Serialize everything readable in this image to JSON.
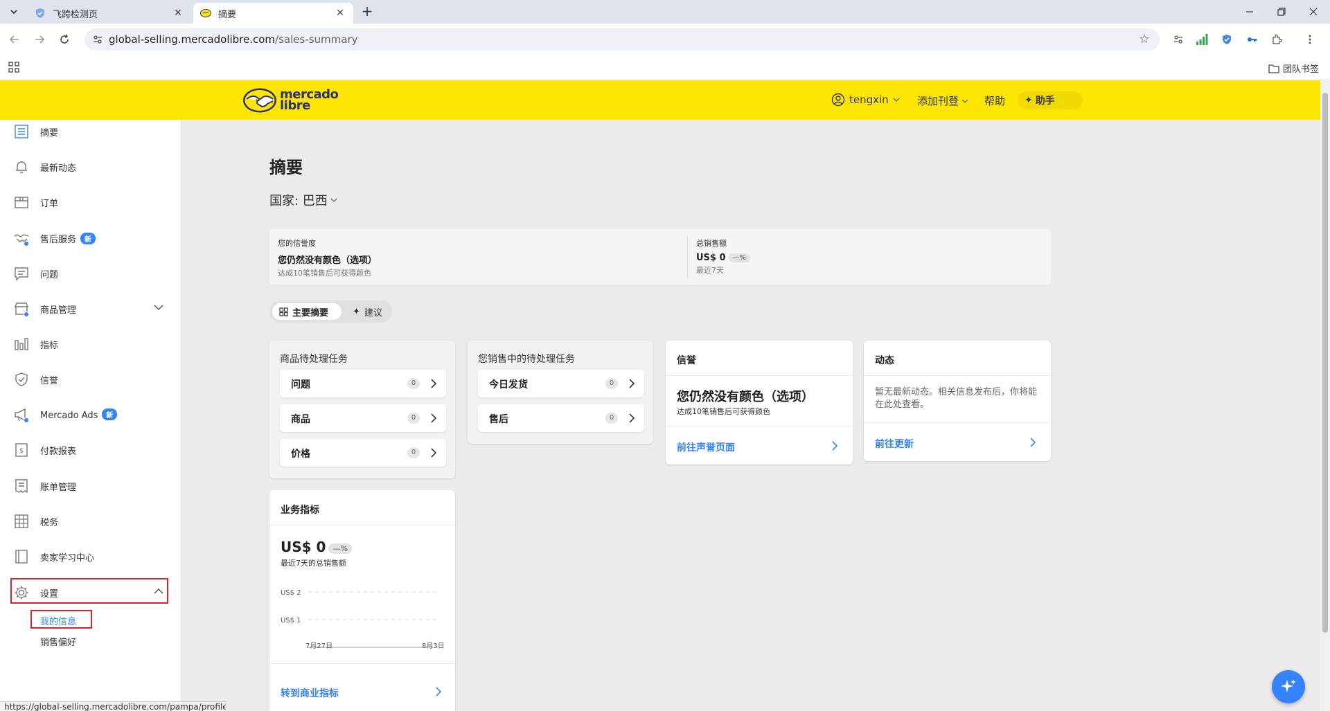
{
  "browser": {
    "tabs": [
      {
        "title": "飞跨检测页",
        "active": false
      },
      {
        "title": "摘要",
        "active": true
      }
    ],
    "url_host": "global-selling.mercadolibre.com",
    "url_path": "/sales-summary",
    "bookmark_folder": "团队书签",
    "status_url": "https://global-selling.mercadolibre.com/pampa/profile"
  },
  "header": {
    "logo_line1": "mercado",
    "logo_line2": "libre",
    "user": "tengxin",
    "menu_publish": "添加刊登",
    "menu_help": "帮助",
    "assistant": "助手"
  },
  "sidebar": {
    "items": [
      {
        "label": "摘要",
        "icon": "list-icon"
      },
      {
        "label": "最新动态",
        "icon": "bell-icon"
      },
      {
        "label": "订单",
        "icon": "box-icon"
      },
      {
        "label": "售后服务",
        "icon": "handshake-icon",
        "badge": "新"
      },
      {
        "label": "问题",
        "icon": "chat-icon"
      },
      {
        "label": "商品管理",
        "icon": "store-icon"
      },
      {
        "label": "指标",
        "icon": "bar-chart-icon"
      },
      {
        "label": "信誉",
        "icon": "shield-icon"
      },
      {
        "label": "Mercado Ads",
        "icon": "megaphone-icon",
        "badge": "新"
      },
      {
        "label": "付款报表",
        "icon": "dollar-doc-icon"
      },
      {
        "label": "账单管理",
        "icon": "receipt-icon"
      },
      {
        "label": "税务",
        "icon": "calculator-icon"
      },
      {
        "label": "卖家学习中心",
        "icon": "book-icon"
      },
      {
        "label": "设置",
        "icon": "gear-icon"
      }
    ],
    "settings_sub": [
      "我的信息",
      "销售偏好"
    ]
  },
  "main": {
    "title": "摘要",
    "country_label": "国家: 巴西",
    "reputation": {
      "label": "您的信誉度",
      "value": "您仍然没有颜色（选项）",
      "sub": "达成10笔销售后可获得颜色"
    },
    "total_sales": {
      "label": "总销售额",
      "value": "US$ 0",
      "pct": "—%",
      "sub": "最近7天"
    },
    "segments": {
      "main": "主要摘要",
      "suggest": "建议"
    },
    "product_tasks": {
      "title": "商品待处理任务",
      "items": [
        {
          "label": "问题",
          "count": "0"
        },
        {
          "label": "商品",
          "count": "0"
        },
        {
          "label": "价格",
          "count": "0"
        }
      ]
    },
    "sales_tasks": {
      "title": "您销售中的待处理任务",
      "items": [
        {
          "label": "今日发货",
          "count": "0"
        },
        {
          "label": "售后",
          "count": "0"
        }
      ]
    },
    "reputation_card": {
      "title": "信誉",
      "value": "您仍然没有颜色（选项）",
      "sub": "达成10笔销售后可获得颜色",
      "link": "前往声誉页面"
    },
    "activity_card": {
      "title": "动态",
      "text": "暂无最新动态。相关信息发布后，你将能在此处查看。",
      "link": "前往更新"
    },
    "metrics_card": {
      "title": "业务指标",
      "value": "US$ 0",
      "pct": "—%",
      "sub": "最近7天的总销售额",
      "link": "转到商业指标"
    }
  },
  "chart_data": {
    "type": "line",
    "x": [
      "7月27日",
      "8月3日"
    ],
    "series": [
      {
        "values": [
          0,
          0
        ]
      }
    ],
    "y_ticks": [
      "US$ 2",
      "US$ 1"
    ],
    "ylim": [
      0,
      2
    ],
    "grid": true
  },
  "colors": {
    "brand_yellow": "#ffe600",
    "accent_blue": "#3483fa",
    "highlight_red": "#d8242c"
  }
}
